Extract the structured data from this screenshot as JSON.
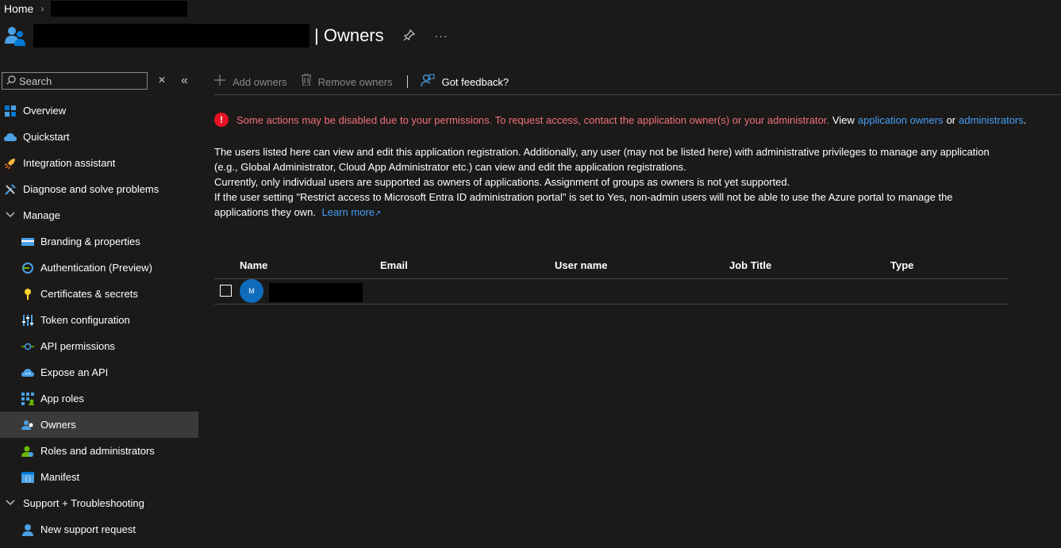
{
  "breadcrumb": {
    "home": "Home",
    "separator": "›"
  },
  "header": {
    "title": "| Owners",
    "pin_glyph": "✎",
    "more_glyph": "···"
  },
  "sidebar": {
    "search_placeholder": "Search",
    "clear_glyph": "✕",
    "collapse_glyph": "«",
    "items": [
      {
        "label": "Overview",
        "icon": "overview-icon",
        "color": "#0078d4"
      },
      {
        "label": "Quickstart",
        "icon": "quickstart-icon",
        "color": "#4aa0e6"
      },
      {
        "label": "Integration assistant",
        "icon": "rocket-icon",
        "color": "#f8b73b"
      },
      {
        "label": "Diagnose and solve problems",
        "icon": "wrench-icon",
        "color": "#4aa0e6"
      },
      {
        "label": "Manage",
        "icon": "chevron-down-icon"
      },
      {
        "label": "Branding & properties",
        "icon": "branding-icon",
        "color": "#4aa0e6"
      },
      {
        "label": "Authentication (Preview)",
        "icon": "authentication-icon",
        "color": "#4aa0e6"
      },
      {
        "label": "Certificates & secrets",
        "icon": "key-icon",
        "color": "#f8d22a"
      },
      {
        "label": "Token configuration",
        "icon": "token-icon",
        "color": "#4aa0e6"
      },
      {
        "label": "API permissions",
        "icon": "api-permissions-icon",
        "color": "#4aa0e6"
      },
      {
        "label": "Expose an API",
        "icon": "cloud-icon",
        "color": "#4aa0e6"
      },
      {
        "label": "App roles",
        "icon": "app-roles-icon",
        "color": "#4aa0e6"
      },
      {
        "label": "Owners",
        "icon": "owners-icon",
        "color": "#4aa0e6"
      },
      {
        "label": "Roles and administrators",
        "icon": "roles-icon",
        "color": "#6bb700"
      },
      {
        "label": "Manifest",
        "icon": "manifest-icon",
        "color": "#4aa0e6"
      },
      {
        "label": "Support + Troubleshooting",
        "icon": "chevron-down-icon"
      },
      {
        "label": "New support request",
        "icon": "support-icon",
        "color": "#4aa0e6"
      }
    ]
  },
  "toolbar": {
    "add_owners": "Add owners",
    "remove_owners": "Remove owners",
    "feedback": "Got feedback?"
  },
  "warning": {
    "message": "Some actions may be disabled due to your permissions. To request access, contact the application owner(s) or your administrator.",
    "view": "View",
    "link1": "application owners",
    "or": "or",
    "link2": "administrators",
    "end": "."
  },
  "description": {
    "line1": "The users listed here can view and edit this application registration. Additionally, any user (may not be listed here) with administrative privileges to manage any application",
    "line2": "(e.g., Global Administrator, Cloud App Administrator etc.) can view and edit the application registrations.",
    "line3": "Currently, only individual users are supported as owners of applications. Assignment of groups as owners is not yet supported.",
    "line4": "If the user setting \"Restrict access to Microsoft Entra ID administration portal\" is set to Yes, non-admin users will not be able to use the Azure portal to manage the",
    "line5": "applications they own.",
    "learn_more": "Learn more",
    "ext_glyph": "↗"
  },
  "table": {
    "columns": [
      "Name",
      "Email",
      "User name",
      "Job Title",
      "Type"
    ],
    "rows": [
      {
        "avatar_initial": "M"
      }
    ]
  },
  "colors": {
    "background": "#1b1a19",
    "accent": "#479ef5",
    "error": "#e81123",
    "error_text": "#f1707b",
    "selected": "#3b3a39"
  }
}
